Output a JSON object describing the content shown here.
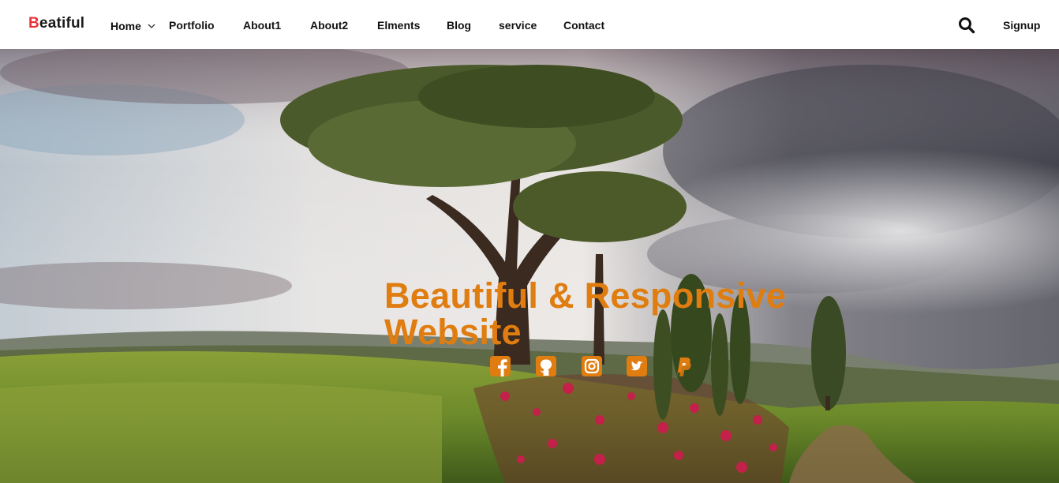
{
  "brand": {
    "first_letter": "B",
    "rest": "eatiful",
    "accent_color": "#e8333a"
  },
  "nav": {
    "items": [
      {
        "label": "Home",
        "has_dropdown": true
      },
      {
        "label": "Portfolio"
      },
      {
        "label": "About1"
      },
      {
        "label": "About2"
      },
      {
        "label": "Elments"
      },
      {
        "label": "Blog"
      },
      {
        "label": "service"
      },
      {
        "label": "Contact"
      }
    ],
    "search_icon": "search-icon",
    "signup_label": "Signup"
  },
  "hero": {
    "title": "Beautiful & Responsive Website",
    "title_color": "#e07d10",
    "social_icons": [
      "facebook-icon",
      "github-icon",
      "instagram-icon",
      "twitter-icon",
      "paypal-icon"
    ]
  }
}
